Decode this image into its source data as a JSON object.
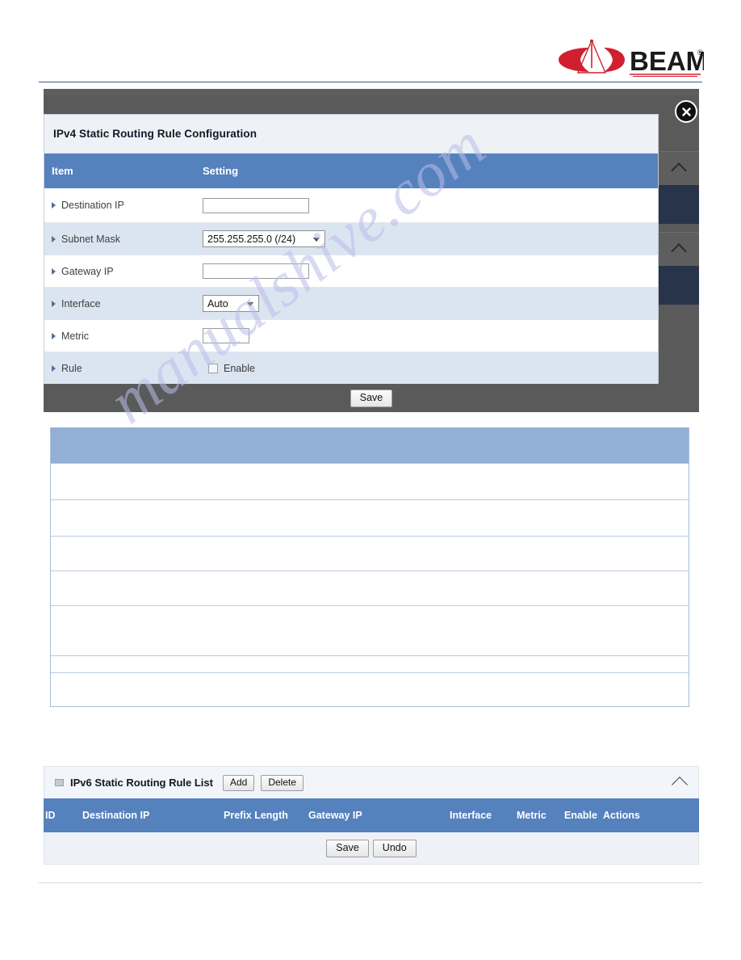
{
  "brand": {
    "logo_text": "BEAM",
    "logo_registered": "®"
  },
  "modal": {
    "title": "IPv4 Static Routing Rule Configuration",
    "close_label": "✕",
    "columns": {
      "item": "Item",
      "setting": "Setting"
    },
    "rows": [
      {
        "label": "Destination IP",
        "control": "text",
        "value": "",
        "placeholder": ""
      },
      {
        "label": "Subnet Mask",
        "control": "select",
        "value": "255.255.255.0 (/24)"
      },
      {
        "label": "Gateway IP",
        "control": "text",
        "value": "",
        "placeholder": ""
      },
      {
        "label": "Interface",
        "control": "select",
        "value": "Auto"
      },
      {
        "label": "Metric",
        "control": "text",
        "value": "",
        "placeholder": ""
      },
      {
        "label": "Rule",
        "control": "checkbox",
        "checkbox_label": "Enable",
        "checked": false
      }
    ],
    "save_label": "Save"
  },
  "ipv6_list": {
    "title": "IPv6 Static Routing Rule List",
    "add_label": "Add",
    "delete_label": "Delete",
    "columns": [
      "ID",
      "Destination IP",
      "Prefix Length",
      "Gateway IP",
      "Interface",
      "Metric",
      "Enable",
      "Actions"
    ],
    "rows": [],
    "save_label": "Save",
    "undo_label": "Undo"
  },
  "middle_table": {
    "header": "",
    "rows": [
      "",
      "",
      "",
      "",
      "",
      "",
      ""
    ]
  },
  "watermark": {
    "text": "manualshive.com"
  },
  "colors": {
    "header_blue": "#5581bd",
    "light_blue_header": "#92b0d6",
    "row_alt": "#dbe5f1",
    "panel_dark": "#5a5a5a",
    "nav_dark": "#27344a",
    "title_bg": "#eef2f7",
    "rule_blue": "#3c5f8a",
    "logo_red": "#d0202f"
  }
}
